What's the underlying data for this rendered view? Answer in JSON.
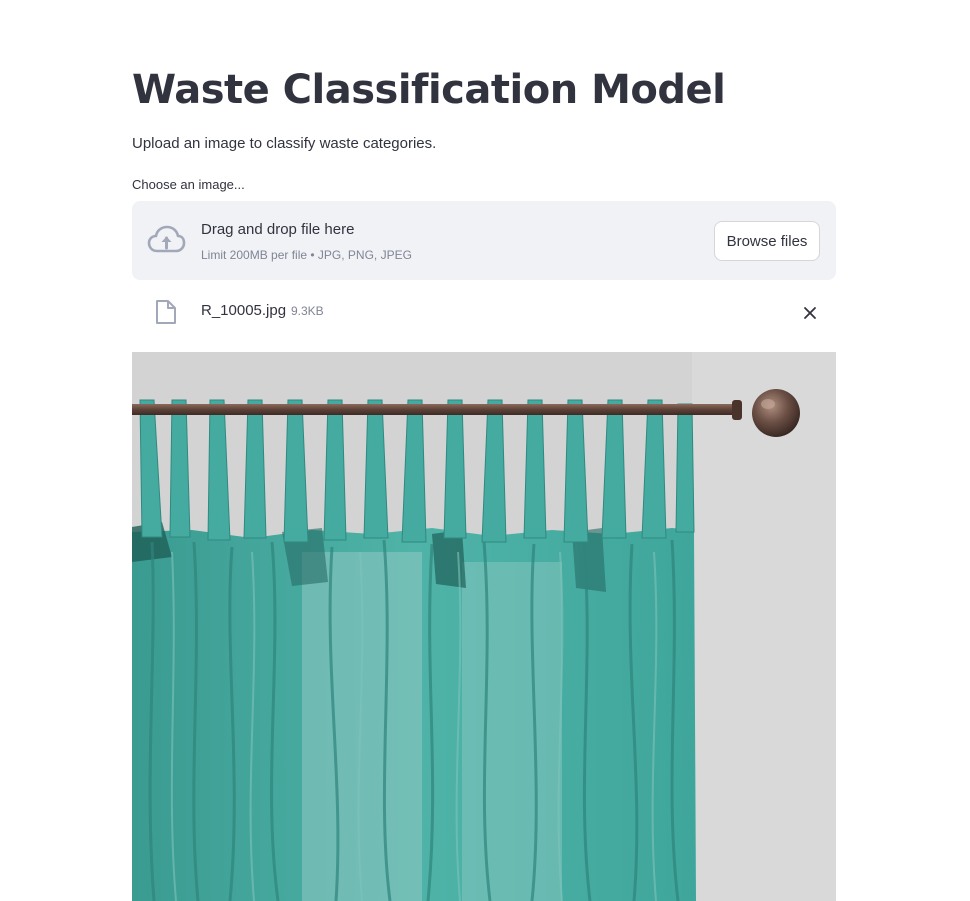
{
  "header": {
    "title": "Waste Classification Model",
    "subtitle": "Upload an image to classify waste categories."
  },
  "uploader": {
    "label": "Choose an image...",
    "drop_text": "Drag and drop file here",
    "limit_text": "Limit 200MB per file • JPG, PNG, JPEG",
    "browse_label": "Browse files",
    "icon": "cloud-upload-icon"
  },
  "uploaded_file": {
    "name": "R_10005.jpg",
    "size": "9.3KB",
    "icon": "file-icon",
    "remove_icon": "close-icon"
  },
  "preview": {
    "description_icon": "image-preview"
  },
  "colors": {
    "text": "#31333f",
    "muted": "#808495",
    "dropzone_bg": "#f0f2f6",
    "icon": "#a3a8b8",
    "curtain": "#3fa69c",
    "wall": "#d3d3d3",
    "rod": "#6b4f45"
  }
}
